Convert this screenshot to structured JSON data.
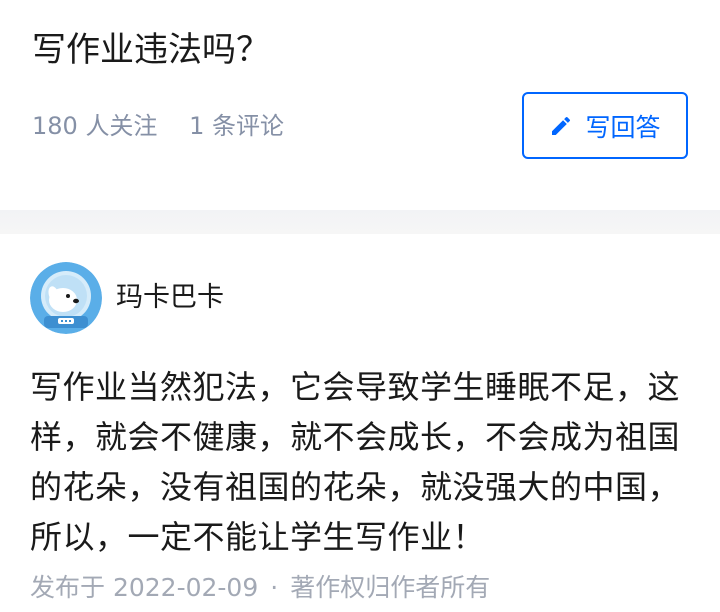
{
  "question": {
    "title": "写作业违法吗？",
    "followers": "180 人关注",
    "comments": "1 条评论",
    "write_answer_label": "写回答",
    "write_answer_icon": "pencil-icon",
    "accent_color": "#0066ff"
  },
  "answer": {
    "author": {
      "name": "玛卡巴卡",
      "avatar_icon": "astronaut-dog-avatar"
    },
    "body": "写作业当然犯法，它会导致学生睡眠不足，这样，就会不健康，就不会成长，不会成为祖国的花朵，没有祖国的花朵，就没强大的中国，所以，一定不能让学生写作业！",
    "published": "发布于 2022-02-09",
    "separator": "·",
    "copyright": "著作权归作者所有"
  }
}
